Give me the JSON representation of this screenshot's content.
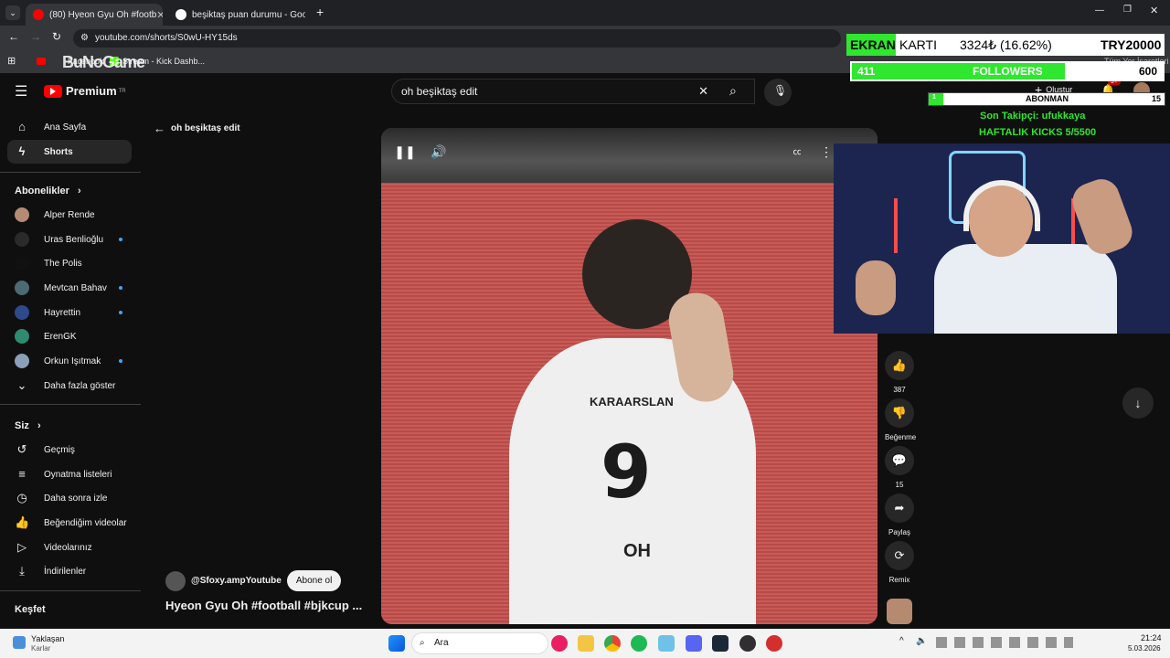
{
  "browser": {
    "tabs": [
      {
        "title": "(80) Hyeon Gyu Oh #footb",
        "active": true
      },
      {
        "title": "beşiktaş puan durumu - Google",
        "active": false
      }
    ],
    "url": "youtube.com/shorts/S0wU-HY15ds",
    "bookmarks": [
      "Facebook",
      "Stream - Kick Dashb..."
    ],
    "all_bookmarks": "Tüm Yer İşaretleri"
  },
  "header": {
    "logo": "Premium",
    "logo_sup": "TR",
    "search_value": "oh beşiktaş edit",
    "create_label": "Oluştur",
    "notif_count": "9+"
  },
  "sidebar": {
    "home": "Ana Sayfa",
    "shorts": "Shorts",
    "subs_title": "Abonelikler",
    "subscriptions": [
      {
        "name": "Alper Rende",
        "dot": false
      },
      {
        "name": "Uras Benlioğlu",
        "dot": true
      },
      {
        "name": "The Polis",
        "dot": false
      },
      {
        "name": "Mevtcan Bahav",
        "dot": true
      },
      {
        "name": "Hayrettin",
        "dot": true
      },
      {
        "name": "ErenGK",
        "dot": false
      },
      {
        "name": "Orkun Işıtmak",
        "dot": true
      }
    ],
    "show_more": "Daha fazla göster",
    "you_title": "Siz",
    "you_items": [
      "Geçmiş",
      "Oynatma listeleri",
      "Daha sonra izle",
      "Beğendiğim videolar",
      "Videolarınız",
      "İndirilenler"
    ],
    "explore_title": "Keşfet"
  },
  "back_label": "oh beşiktaş edit",
  "video": {
    "jersey_number": "9",
    "jersey_name": "OH",
    "sponsor": "KARAARSLAN",
    "channel": "@Sfoxy.ampYoutube",
    "subscribe": "Abone ol",
    "title": "Hyeon Gyu Oh #football #bjkcup ..."
  },
  "actions": {
    "likes": "387",
    "dislike": "Beğenme",
    "comments": "15",
    "share": "Paylaş",
    "remix": "Remix"
  },
  "stream_overlay": {
    "goal_label_1": "EKRAN",
    "goal_label_2": "KARTI",
    "goal_amount": "3324₺ (16.62%)",
    "goal_target": "TRY20000",
    "followers_current": "411",
    "followers_label": "FOLLOWERS",
    "followers_target": "600",
    "followers_fraction": 0.685,
    "subs_current": "1",
    "subs_label": "ABONMAN",
    "subs_target": "15",
    "last_follower": "Son Takipçi: ufukkaya",
    "weekly_kicks": "HAFTALIK KICKS 5/5500"
  },
  "taskbar": {
    "weather_title": "Yaklaşan",
    "weather_sub": "Karlar",
    "search_placeholder": "Ara",
    "time": "21:24",
    "date": "5.03.2026"
  },
  "colors": {
    "yt_red": "#ff0000",
    "overlay_green": "#2ee72e",
    "accent_blue": "#3ea6ff"
  }
}
